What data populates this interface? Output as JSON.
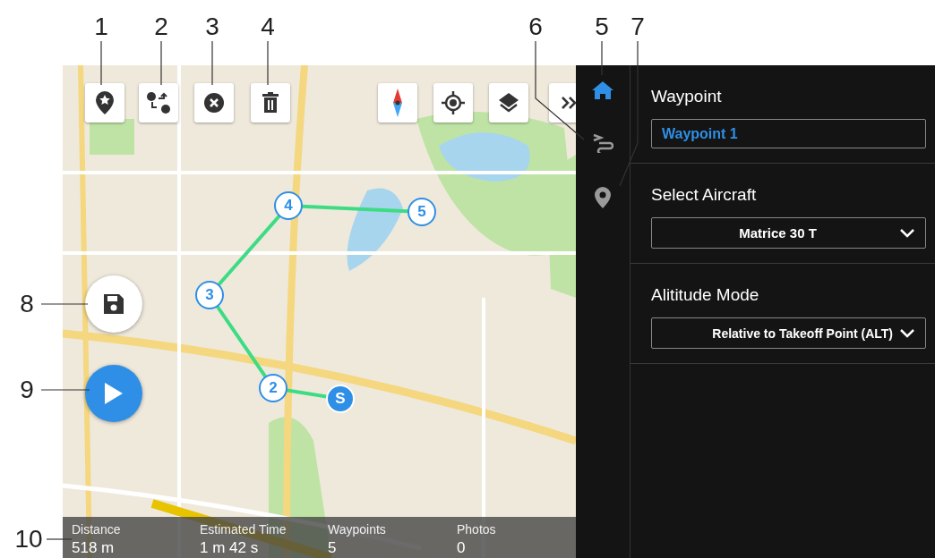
{
  "callouts": [
    "1",
    "2",
    "3",
    "4",
    "6",
    "5",
    "7",
    "8",
    "9",
    "10"
  ],
  "map_toolbar": {
    "buttons": [
      {
        "kind": "favorite-pin"
      },
      {
        "kind": "swap-start-end"
      },
      {
        "kind": "clear"
      },
      {
        "kind": "delete"
      },
      {
        "kind": "compass"
      },
      {
        "kind": "locate"
      },
      {
        "kind": "layers"
      },
      {
        "kind": "expand"
      }
    ]
  },
  "waypoints": [
    {
      "label": "S"
    },
    {
      "label": "2"
    },
    {
      "label": "3"
    },
    {
      "label": "4"
    },
    {
      "label": "5"
    }
  ],
  "summary": [
    {
      "label": "Distance",
      "value": "518 m"
    },
    {
      "label": "Estimated Time",
      "value": "1 m 42 s"
    },
    {
      "label": "Waypoints",
      "value": "5"
    },
    {
      "label": "Photos",
      "value": "0"
    }
  ],
  "sidebar": {
    "items": [
      {
        "kind": "home",
        "selected": true
      },
      {
        "kind": "route",
        "selected": false
      },
      {
        "kind": "pin",
        "selected": false
      }
    ]
  },
  "panel": {
    "sections": [
      {
        "label": "Waypoint",
        "kind": "input",
        "value": "Waypoint 1"
      },
      {
        "label": "Select Aircraft",
        "kind": "select",
        "value": "Matrice 30 T"
      },
      {
        "label": "Alititude Mode",
        "kind": "select",
        "value": "Relative to Takeoff Point (ALT)"
      }
    ]
  }
}
